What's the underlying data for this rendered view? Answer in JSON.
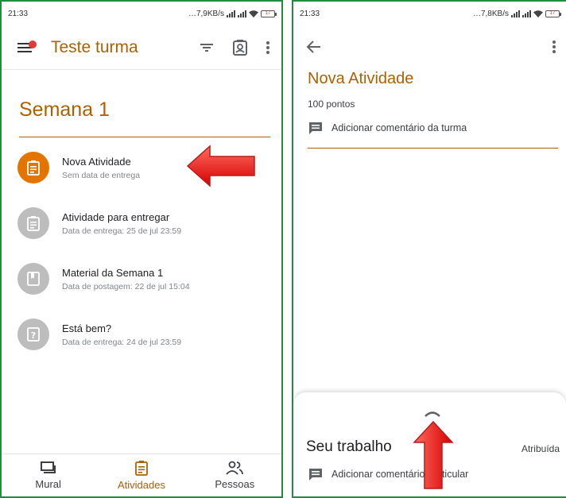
{
  "left": {
    "status": {
      "time": "21:33",
      "speed": "7,9KB/s",
      "battery": "17"
    },
    "class_title": "Teste turma",
    "topic": "Semana 1",
    "items": [
      {
        "title": "Nova Atividade",
        "subtitle": "Sem data de entrega",
        "icon": "assignment-icon",
        "active": true
      },
      {
        "title": "Atividade para entregar",
        "subtitle": "Data de entrega: 25 de jul 23:59",
        "icon": "assignment-icon",
        "active": false
      },
      {
        "title": "Material da Semana 1",
        "subtitle": "Data de postagem: 22 de jul 15:04",
        "icon": "book-icon",
        "active": false
      },
      {
        "title": "Está bem?",
        "subtitle": "Data de entrega: 24 de jul 23:59",
        "icon": "question-icon",
        "active": false
      }
    ],
    "nav": {
      "mural": "Mural",
      "atividades": "Atividades",
      "pessoas": "Pessoas"
    }
  },
  "right": {
    "status": {
      "time": "21:33",
      "speed": "7,8KB/s",
      "battery": "17"
    },
    "title": "Nova Atividade",
    "points": "100 pontos",
    "class_comment": "Adicionar comentário da turma",
    "sheet": {
      "title": "Seu trabalho",
      "status": "Atribuída",
      "private_comment": "Adicionar comentário particular"
    }
  },
  "colors": {
    "accent": "#b06000",
    "active_circle": "#e37400",
    "inactive_circle": "#bdbdbd",
    "arrow": "#e53935",
    "frame": "#1e8e3e"
  }
}
